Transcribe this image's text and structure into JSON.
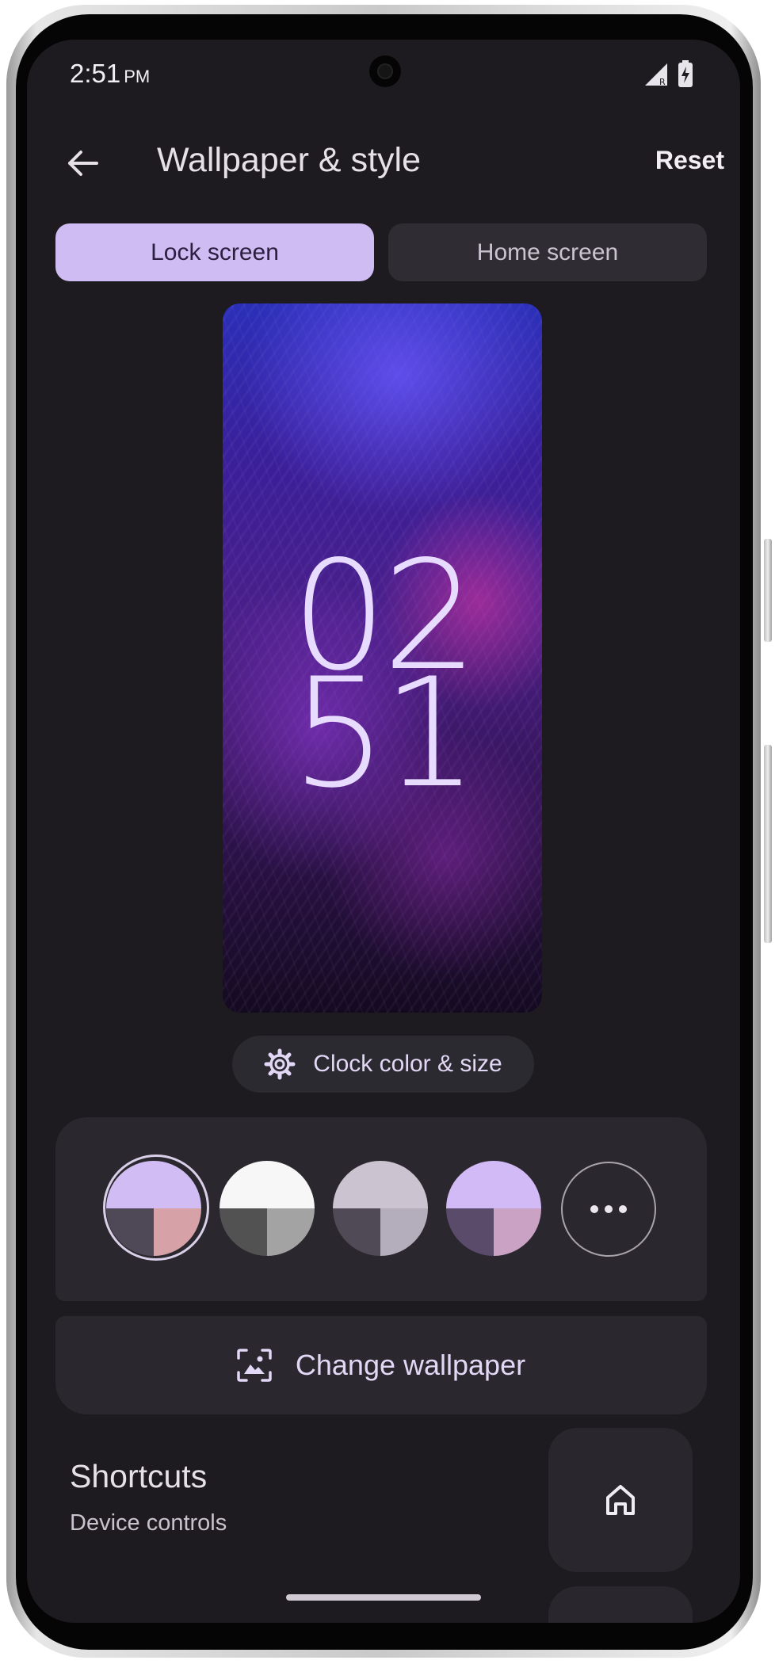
{
  "status_bar": {
    "time": "2:51",
    "am_pm": "PM",
    "icons": [
      "cellular-signal-icon",
      "battery-charging-icon"
    ]
  },
  "header": {
    "back_icon": "arrow-back-icon",
    "title": "Wallpaper & style",
    "reset_label": "Reset"
  },
  "tabs": [
    {
      "label": "Lock screen",
      "selected": true
    },
    {
      "label": "Home screen",
      "selected": false
    }
  ],
  "preview": {
    "clock_hours": "02",
    "clock_minutes": "51"
  },
  "clock_button": {
    "icon": "gear-icon",
    "label": "Clock color & size"
  },
  "color_options": {
    "swatches": [
      {
        "top": "#d1bcf4",
        "bottom_left": "#4f4856",
        "bottom_right": "#d6a2a8",
        "selected": true
      },
      {
        "top": "#f7f7f7",
        "bottom_left": "#525252",
        "bottom_right": "#a3a3a3",
        "selected": false
      },
      {
        "top": "#cbc3cf",
        "bottom_left": "#4f4a55",
        "bottom_right": "#b3adbc",
        "selected": false
      },
      {
        "top": "#d1baf5",
        "bottom_left": "#5a4b6b",
        "bottom_right": "#c9a2c4",
        "selected": false
      }
    ],
    "more_icon": "more-horiz-icon"
  },
  "change_wallpaper": {
    "icon": "wallpaper-icon",
    "label": "Change wallpaper"
  },
  "shortcuts": {
    "title": "Shortcuts",
    "subtitle": "Device controls",
    "tile_icon": "home-icon"
  },
  "colors": {
    "background": "#1d1b20",
    "accent": "#cfbcf2",
    "surface": "#2a282e"
  }
}
